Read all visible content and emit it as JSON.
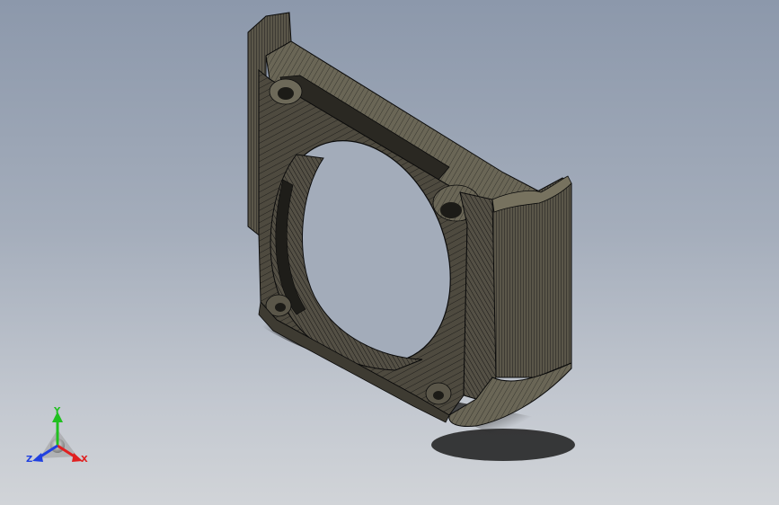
{
  "viewport": {
    "background_top": "#8c98ab",
    "background_bottom": "#d1d4d8",
    "model": {
      "render_mode": "shaded-with-edges",
      "face_color": "#575347",
      "edge_color": "#0b0b0b",
      "shadow_color": "#232323"
    },
    "triad": {
      "x_label": "X",
      "y_label": "Y",
      "z_label": "Z",
      "x_color": "#e02020",
      "y_color": "#20c020",
      "z_color": "#2040e0"
    }
  }
}
